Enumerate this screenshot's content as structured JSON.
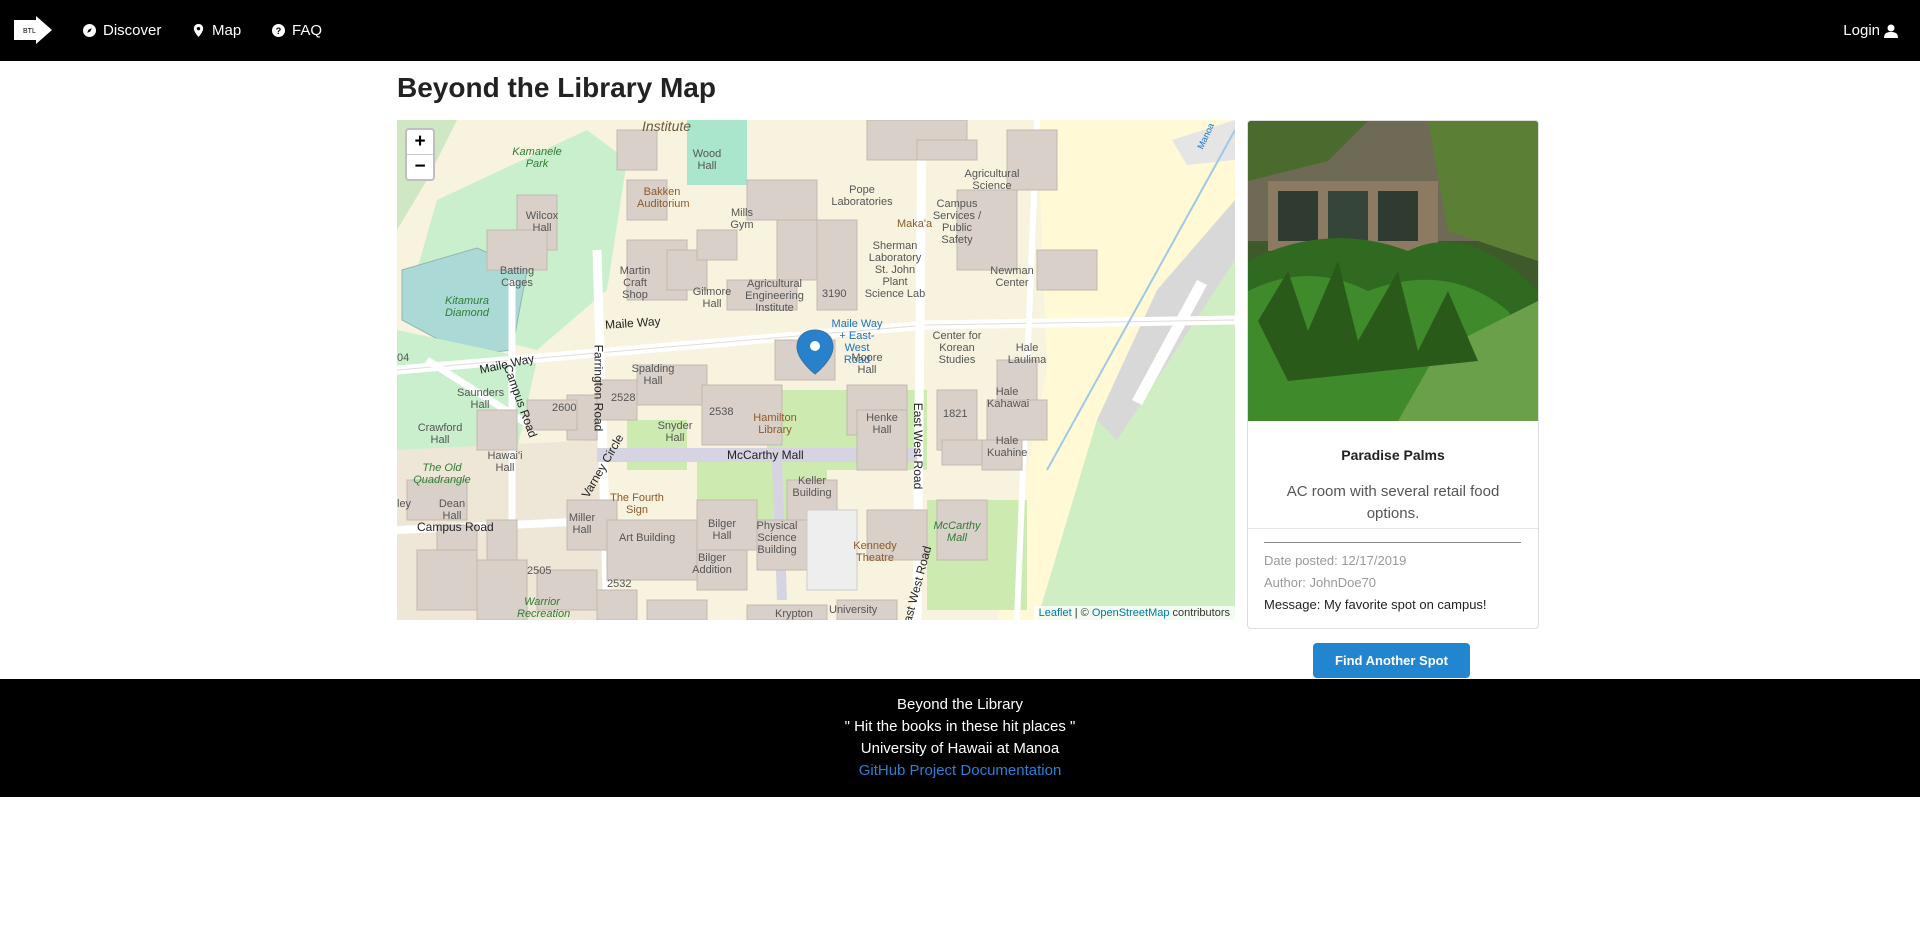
{
  "nav": {
    "brand_text": "BTL",
    "items": [
      {
        "label": "Discover",
        "icon": "compass-icon"
      },
      {
        "label": "Map",
        "icon": "map-marker-icon"
      },
      {
        "label": "FAQ",
        "icon": "question-circle-icon"
      }
    ],
    "login_label": "Login",
    "login_icon": "user-icon"
  },
  "page": {
    "title": "Beyond the Library Map"
  },
  "map": {
    "zoom_in": "+",
    "zoom_out": "−",
    "attribution_leaflet": "Leaflet",
    "attribution_sep": " | © ",
    "attribution_osm": "OpenStreetMap",
    "attribution_suffix": " contributors",
    "labels": {
      "institute": "Institute",
      "kamanele": "Kamanele Park",
      "wood_hall": "Wood Hall",
      "bakken": "Bakken Auditorium",
      "wilcox": "Wilcox Hall",
      "batting": "Batting Cages",
      "kitamura": "Kitamura Diamond",
      "mills_gym": "Mills Gym",
      "martin_craft": "Martin Craft Shop",
      "gilmore": "Gilmore Hall",
      "ag_eng": "Agricultural Engineering Institute",
      "n3190": "3190",
      "pope": "Pope Laboratories",
      "makaa": "Maka'a",
      "sherman": "Sherman Laboratory St. John Plant Science Lab",
      "ag_science": "Agricultural Science",
      "campus_services": "Campus Services / Public Safety",
      "newman": "Newman Center",
      "maile_way_1": "Maile Way",
      "maile_way_2": "Maile Way",
      "bus_stop": "Maile Way + East-West Road",
      "farrington": "Farrington Road",
      "campus_road_v": "Campus Road",
      "spalding": "Spalding Hall",
      "saunders": "Saunders Hall",
      "n2528": "2528",
      "n2600": "2600",
      "n2538": "2538",
      "moore": "Moore Hall",
      "korean": "Center for Korean Studies",
      "hale_laulima": "Hale Laulima",
      "hale_kahawai": "Hale Kahawai",
      "crawford": "Crawford Hall",
      "snyder": "Snyder Hall",
      "hamilton": "Hamilton Library",
      "henke": "Henke Hall",
      "n1821": "1821",
      "hale_kuahine": "Hale Kuahine",
      "hawaii_hall": "Hawai'i Hall",
      "varney": "Varney Circle",
      "mccarthy_mall": "McCarthy Mall",
      "old_quad": "The Old Quadrangle",
      "east_west": "East West Road",
      "dean": "Dean Hall",
      "fourth_sign": "The Fourth Sign",
      "keller": "Keller Building",
      "campus_road_h": "Campus Road",
      "miller": "Miller Hall",
      "art": "Art Building",
      "bilger": "Bilger Hall",
      "physical": "Physical Science Building",
      "kennedy": "Kennedy Theatre",
      "mccarthy_mall_green": "McCarthy Mall",
      "n2505": "2505",
      "n2532": "2532",
      "bilger_add": "Bilger Addition",
      "warrior": "Warrior Recreation",
      "krypton": "Krypton",
      "university": "University",
      "east_west_2": "East West Road",
      "n04": "04",
      "ley": "ley",
      "manoa": "Manoa"
    }
  },
  "spot": {
    "name": "Paradise Palms",
    "description": "AC room with several retail food options.",
    "date_posted": "Date posted: 12/17/2019",
    "author": "Author: JohnDoe70",
    "message": "Message: My favorite spot on campus!"
  },
  "find_button": "Find Another Spot",
  "footer": {
    "line1": "Beyond the Library",
    "line2": "\" Hit the books in these hit places \"",
    "line3": "University of Hawaii at Manoa",
    "link": "GitHub Project Documentation"
  },
  "colors": {
    "navbar_bg": "#000000",
    "button_bg": "#2185d0",
    "link": "#2f7fd6",
    "map_marker": "#2a81cb"
  }
}
